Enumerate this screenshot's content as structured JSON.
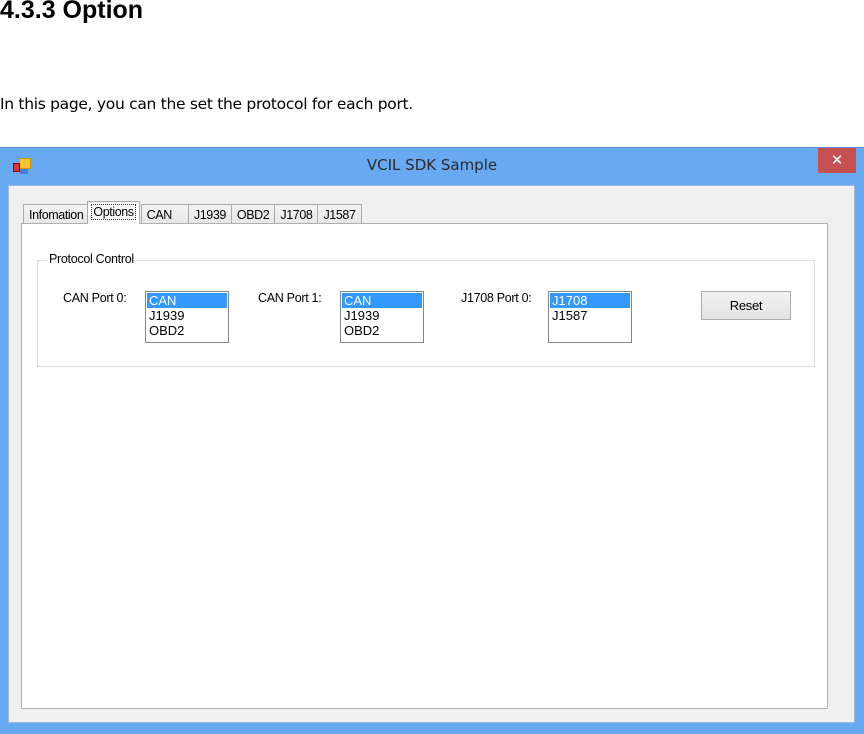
{
  "document": {
    "heading": "4.3.3 Option",
    "paragraph": "In this page, you can the set the protocol for each port."
  },
  "window": {
    "title": "VCIL SDK Sample",
    "app_icon": "application-icon",
    "close_label": "✕"
  },
  "tabs": [
    {
      "label": "Infomation",
      "active": false
    },
    {
      "label": "Options",
      "active": true
    },
    {
      "label": "CAN",
      "active": false
    },
    {
      "label": "J1939",
      "active": false
    },
    {
      "label": "OBD2",
      "active": false
    },
    {
      "label": "J1708",
      "active": false
    },
    {
      "label": "J1587",
      "active": false
    }
  ],
  "protocol_control": {
    "title": "Protocol Control",
    "can_port0": {
      "label": "CAN Port 0:",
      "options": [
        "CAN",
        "J1939",
        "OBD2"
      ],
      "selected": "CAN"
    },
    "can_port1": {
      "label": "CAN Port 1:",
      "options": [
        "CAN",
        "J1939",
        "OBD2"
      ],
      "selected": "CAN"
    },
    "j1708_port0": {
      "label": "J1708 Port 0:",
      "options": [
        "J1708",
        "J1587"
      ],
      "selected": "J1708"
    },
    "reset_label": "Reset"
  },
  "colors": {
    "titlebar": "#68aaf2",
    "close_button": "#c75050",
    "selection": "#3399ff"
  }
}
